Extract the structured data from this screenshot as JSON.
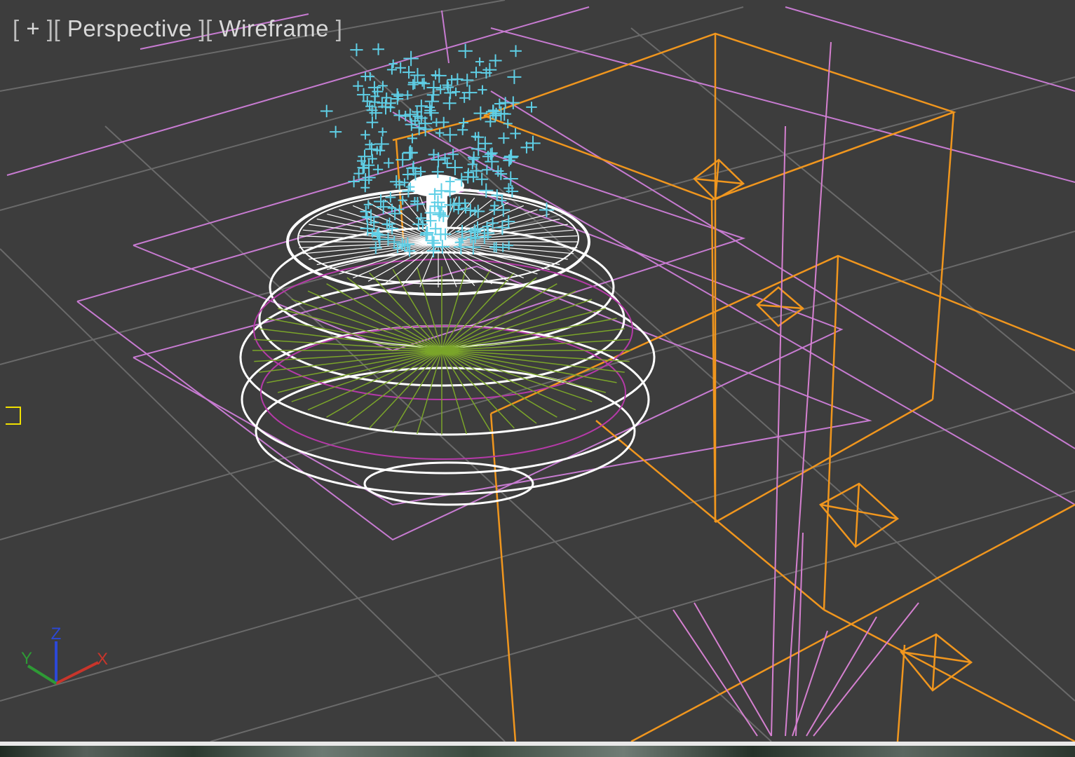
{
  "viewport": {
    "label_plus": "+",
    "label_view": "Perspective",
    "label_shading": "Wireframe",
    "background_color": "#3d3d3d",
    "grid_color": "#666666"
  },
  "scene": {
    "objects": [
      {
        "name": "fountain",
        "color": "#ffffff"
      },
      {
        "name": "water-particles",
        "color": "#5fcfe6"
      },
      {
        "name": "ground-planes",
        "color": "#c77bd1"
      },
      {
        "name": "orange-box-frames",
        "color": "#f0961e"
      },
      {
        "name": "plant-stems",
        "color": "#d580d0"
      }
    ]
  },
  "axis_gizmo": {
    "x_label": "X",
    "y_label": "Y",
    "z_label": "Z",
    "x_color": "#c8352b",
    "y_color": "#2e9a35",
    "z_color": "#2c48d6"
  },
  "icons": {
    "side_marker": "yellow-bracket-icon"
  }
}
